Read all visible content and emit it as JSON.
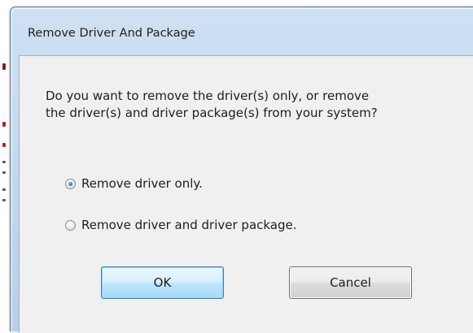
{
  "dialog": {
    "title": "Remove Driver And Package",
    "question_line1": "Do you want to remove the driver(s) only, or remove",
    "question_line2": "the driver(s) and driver package(s) from your system?",
    "options": [
      {
        "label": "Remove driver only.",
        "selected": true
      },
      {
        "label": "Remove driver and driver package.",
        "selected": false
      }
    ],
    "buttons": {
      "ok_label": "OK",
      "cancel_label": "Cancel"
    }
  },
  "colors": {
    "frame": "#c1d6ee",
    "client": "#f0f0f0",
    "default_button": "#bee6fd",
    "radio_dot": "#2a7fcf"
  },
  "icons": {
    "radio_selected": "radio-selected-icon",
    "radio_unselected": "radio-unselected-icon"
  }
}
